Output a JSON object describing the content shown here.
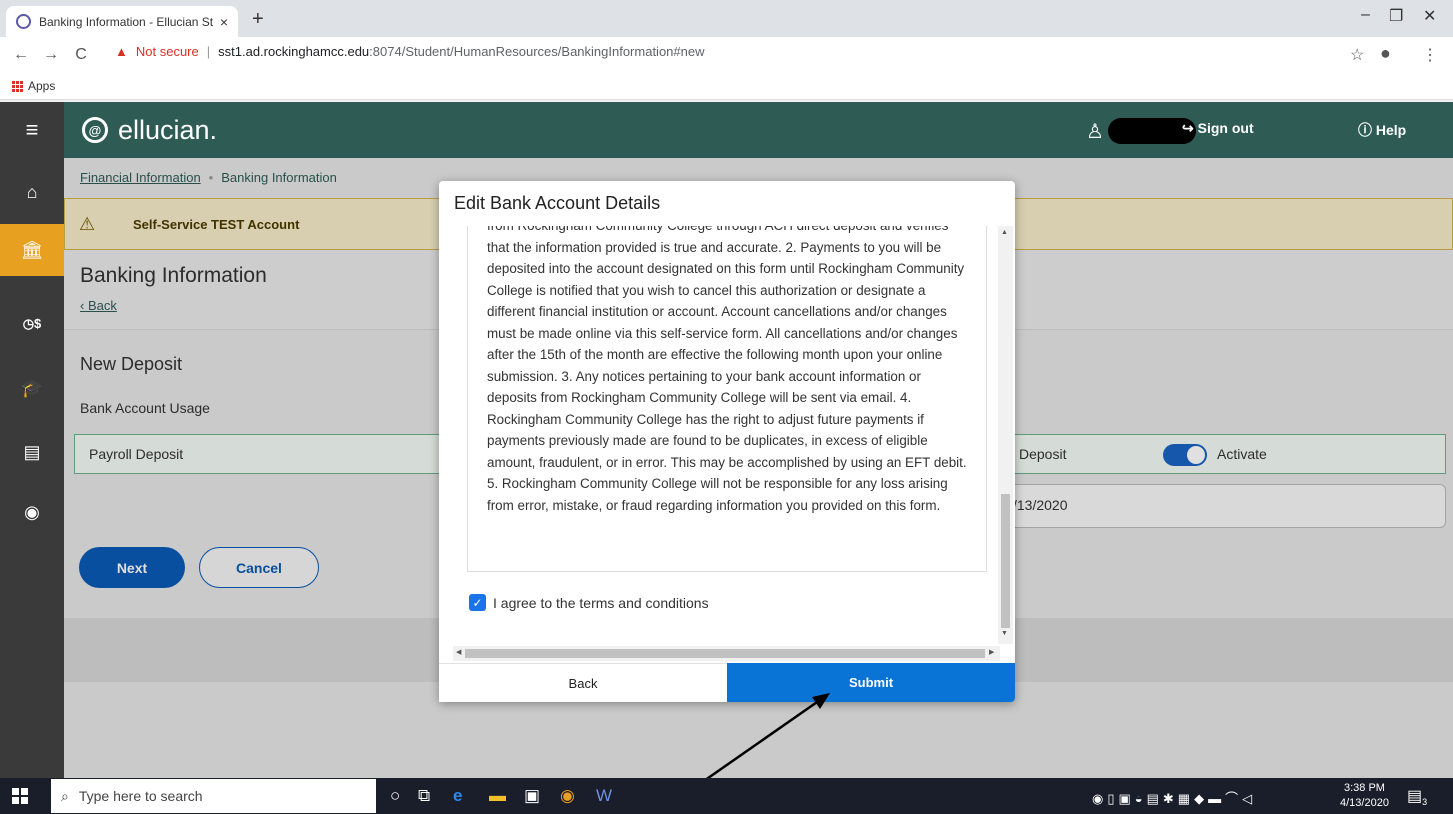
{
  "browser": {
    "tab_title": "Banking Information - Ellucian St",
    "tab_close": "×",
    "new_tab": "+",
    "not_secure": "Not secure",
    "url_host": "sst1.ad.rockinghamcc.edu",
    "url_path": ":8074/Student/HumanResources/BankingInformation#new",
    "bookmarks_apps": "Apps",
    "win_minimize": "–",
    "win_restore": "❐",
    "win_close": "✕"
  },
  "header": {
    "logo_text": "ellucian.",
    "sign_out": "Sign out",
    "help": "Help"
  },
  "breadcrumb": {
    "parent": "Financial Information",
    "current": "Banking Information"
  },
  "test_banner": "Self-Service TEST Account",
  "page": {
    "title": "Banking Information",
    "back": "Back",
    "section_title": "New Deposit",
    "usage_label": "Bank Account Usage",
    "payroll_label": "Payroll Deposit",
    "deposit_label": "Deposit",
    "activate_label": "Activate",
    "activate_on": true,
    "date_value": "/13/2020",
    "next_button": "Next",
    "cancel_button": "Cancel"
  },
  "modal": {
    "title": "Edit Bank Account Details",
    "terms_partial_line": "from Rockingham Community College through ACH direct deposit and verifies",
    "terms_text": "that the information provided is true and accurate. 2. Payments to you will be deposited into the account designated on this form until Rockingham Community College is notified that you wish to cancel this authorization or designate a different financial institution or account. Account cancellations and/or changes must be made online via this self-service form. All cancellations and/or changes after the 15th of the month are effective the following month upon your online submission. 3. Any notices pertaining to your bank account information or deposits from Rockingham Community College will be sent via email. 4. Rockingham Community College has the right to adjust future payments if payments previously made are found to be duplicates, in excess of eligible amount, fraudulent, or in error. This may be accomplished by using an EFT debit. 5. Rockingham Community College will not be responsible for any loss arising from error, mistake, or fraud regarding information you provided on this form.",
    "agree_label": "I agree to the terms and conditions",
    "agree_checked": true,
    "back_button": "Back",
    "submit_button": "Submit"
  },
  "taskbar": {
    "search_placeholder": "Type here to search",
    "time": "3:38 PM",
    "date": "4/13/2020",
    "notification_count": "3"
  },
  "colors": {
    "header_green": "#2e5c54",
    "primary_blue": "#0a5bb5",
    "submit_blue": "#0a74d6",
    "active_nav": "#e8a020"
  }
}
